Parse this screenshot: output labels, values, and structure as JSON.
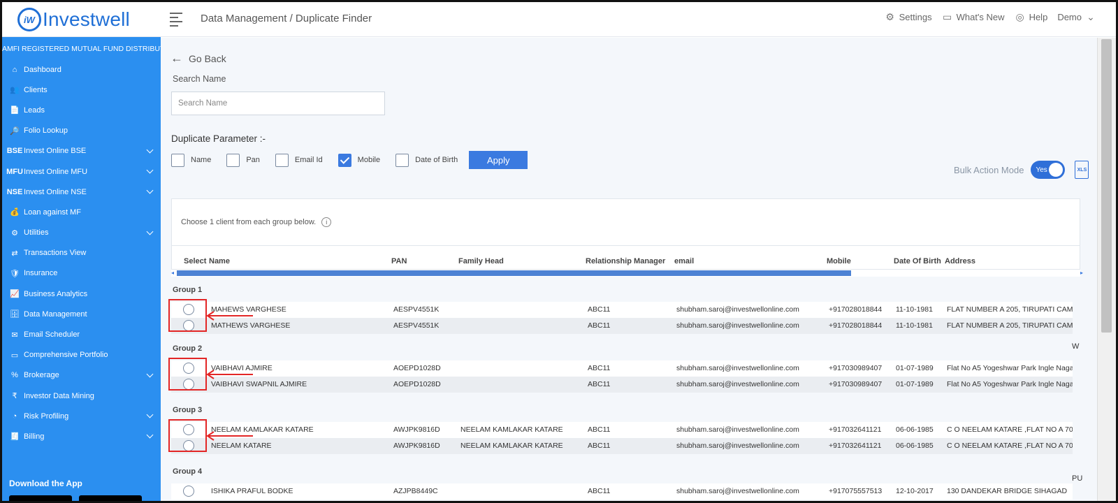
{
  "header": {
    "logo_mark": "iW",
    "logo_text": "Investwell",
    "breadcrumb": "Data Management / Duplicate Finder",
    "settings": "Settings",
    "whats_new": "What's New",
    "help": "Help",
    "user": "Demo"
  },
  "sidebar": {
    "tagline": "AMFI REGISTERED MUTUAL FUND DISTRIBUTOR",
    "items": [
      {
        "label": "Dashboard",
        "icon": "home-icon",
        "glyph": "⌂",
        "chevron": false
      },
      {
        "label": "Clients",
        "icon": "users-icon",
        "glyph": "👥",
        "chevron": false
      },
      {
        "label": "Leads",
        "icon": "document-icon",
        "glyph": "📄",
        "chevron": false
      },
      {
        "label": "Folio Lookup",
        "icon": "folio-search-icon",
        "glyph": "🔎",
        "chevron": false
      },
      {
        "label": "Invest Online BSE",
        "icon": "bse-icon",
        "glyph": "BSE",
        "chevron": true
      },
      {
        "label": "Invest Online MFU",
        "icon": "mfu-icon",
        "glyph": "MFU",
        "chevron": true
      },
      {
        "label": "Invest Online NSE",
        "icon": "nse-icon",
        "glyph": "NSE",
        "chevron": true
      },
      {
        "label": "Loan against MF",
        "icon": "loan-icon",
        "glyph": "💰",
        "chevron": false
      },
      {
        "label": "Utilities",
        "icon": "utilities-icon",
        "glyph": "⚙",
        "chevron": true
      },
      {
        "label": "Transactions View",
        "icon": "transfer-icon",
        "glyph": "⇄",
        "chevron": false
      },
      {
        "label": "Insurance",
        "icon": "insurance-icon",
        "glyph": "🛡",
        "chevron": false
      },
      {
        "label": "Business Analytics",
        "icon": "analytics-icon",
        "glyph": "📈",
        "chevron": false
      },
      {
        "label": "Data Management",
        "icon": "database-icon",
        "glyph": "🗄",
        "chevron": false
      },
      {
        "label": "Email Scheduler",
        "icon": "email-icon",
        "glyph": "✉",
        "chevron": false
      },
      {
        "label": "Comprehensive Portfolio",
        "icon": "portfolio-icon",
        "glyph": "▭",
        "chevron": false
      },
      {
        "label": "Brokerage",
        "icon": "brokerage-icon",
        "glyph": "%",
        "chevron": true
      },
      {
        "label": "Investor Data Mining",
        "icon": "rupee-icon",
        "glyph": "₹",
        "chevron": false
      },
      {
        "label": "Risk Profiling",
        "icon": "risk-icon",
        "glyph": "◔",
        "chevron": true
      },
      {
        "label": "Billing",
        "icon": "billing-icon",
        "glyph": "🧾",
        "chevron": true
      }
    ],
    "download": "Download the App"
  },
  "page": {
    "go_back": "Go Back",
    "search_label": "Search Name",
    "search_placeholder": "Search Name",
    "search_value": "",
    "dup_title": "Duplicate Parameter :-",
    "params": [
      {
        "label": "Name",
        "checked": false
      },
      {
        "label": "Pan",
        "checked": false
      },
      {
        "label": "Email Id",
        "checked": false
      },
      {
        "label": "Mobile",
        "checked": true
      },
      {
        "label": "Date of Birth",
        "checked": false
      }
    ],
    "apply": "Apply",
    "bulk_label": "Bulk Action Mode",
    "bulk_state": "Yes",
    "xls": "XLS",
    "info_text": "Choose 1 client from each group below.",
    "info_icon": "i"
  },
  "table": {
    "headers": [
      "Select",
      "Name",
      "PAN",
      "Family Head",
      "Relationship Manager",
      "email",
      "Mobile",
      "Date Of Birth",
      "Address"
    ],
    "groups": [
      {
        "label": "Group 1",
        "rows": [
          {
            "name": "MAHEWS VARGHESE",
            "pan": "AESPV4551K",
            "family": "",
            "rm": "ABC11",
            "email": "shubham.saroj@investwellonline.com",
            "mobile": "+917028018844",
            "dob": "11-10-1981",
            "address": "FLAT NUMBER A 205, TIRUPATI CAM"
          },
          {
            "name": "MATHEWS VARGHESE",
            "pan": "AESPV4551K",
            "family": "",
            "rm": "ABC11",
            "email": "shubham.saroj@investwellonline.com",
            "mobile": "+917028018844",
            "dob": "11-10-1981",
            "address": "FLAT NUMBER A 205, TIRUPATI CAM"
          }
        ]
      },
      {
        "label": "Group 2",
        "rows": [
          {
            "name": "VAIBHAVI AJMIRE",
            "pan": "AOEPD1028D",
            "family": "",
            "rm": "ABC11",
            "email": "shubham.saroj@investwellonline.com",
            "mobile": "+917030989407",
            "dob": "01-07-1989",
            "address": "Flat No A5 Yogeshwar Park Ingle Nagar"
          },
          {
            "name": "VAIBHAVI SWAPNIL AJMIRE",
            "pan": "AOEPD1028D",
            "family": "",
            "rm": "ABC11",
            "email": "shubham.saroj@investwellonline.com",
            "mobile": "+917030989407",
            "dob": "01-07-1989",
            "address": "Flat No A5 Yogeshwar Park Ingle Nagar"
          }
        ]
      },
      {
        "label": "Group 3",
        "rows": [
          {
            "name": "NEELAM KAMLAKAR KATARE",
            "pan": "AWJPK9816D",
            "family": "NEELAM KAMLAKAR KATARE",
            "rm": "ABC11",
            "email": "shubham.saroj@investwellonline.com",
            "mobile": "+917032641121",
            "dob": "06-06-1985",
            "address": "C O NEELAM KATARE ,FLAT NO A 70"
          },
          {
            "name": "NEELAM KATARE",
            "pan": "AWJPK9816D",
            "family": "NEELAM KAMLAKAR KATARE",
            "rm": "ABC11",
            "email": "shubham.saroj@investwellonline.com",
            "mobile": "+917032641121",
            "dob": "06-06-1985",
            "address": "C O NEELAM KATARE ,FLAT NO A 70"
          }
        ]
      },
      {
        "label": "Group 4",
        "rows": [
          {
            "name": "ISHIKA PRAFUL BODKE",
            "pan": "AZJPB8449C",
            "family": "",
            "rm": "ABC11",
            "email": "shubham.saroj@investwellonline.com",
            "mobile": "+917075557513",
            "dob": "12-10-2017",
            "address": "130 DANDEKAR BRIDGE SIHAGAD"
          }
        ]
      }
    ],
    "stubs": [
      "W",
      "PU"
    ]
  },
  "colors": {
    "sidebar": "#2b8ff0",
    "accent": "#3b7ae0",
    "highlight": "#e32626"
  }
}
